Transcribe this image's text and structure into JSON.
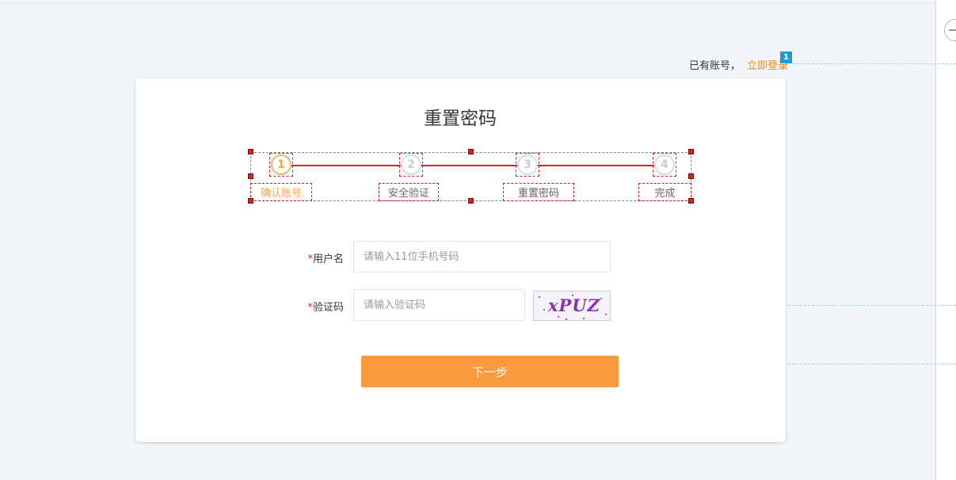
{
  "header": {
    "have_account_label": "已有账号，",
    "login_link": "立即登录",
    "note_badge": "1"
  },
  "card": {
    "title": "重置密码"
  },
  "steps": [
    {
      "number": "1",
      "label": "确认账号",
      "active": true
    },
    {
      "number": "2",
      "label": "安全验证",
      "active": false
    },
    {
      "number": "3",
      "label": "重置密码",
      "active": false
    },
    {
      "number": "4",
      "label": "完成",
      "active": false
    }
  ],
  "form": {
    "required_mark": "*",
    "username": {
      "label": "用户名",
      "placeholder": "请输入11位手机号码",
      "value": ""
    },
    "captcha": {
      "label": "验证码",
      "placeholder": "请输入验证码",
      "value": "",
      "image_text": "xPUZ"
    },
    "next_button": "下一步"
  },
  "colors": {
    "accent": "#fb9a3c",
    "link": "#f7851f",
    "required": "#e02020",
    "badge": "#1e9bd7",
    "page_bg": "#f3f6f9"
  },
  "icons": {
    "collapse": "minus-circle-icon"
  }
}
